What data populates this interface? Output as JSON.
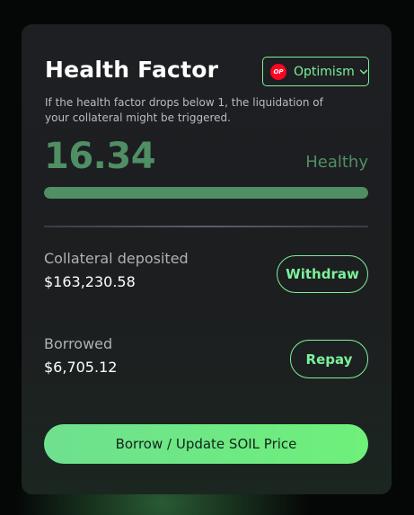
{
  "card": {
    "title": "Health Factor",
    "network": {
      "logo_text": "OP",
      "name": "Optimism",
      "icon": "chevron-down-icon"
    },
    "description": "If the health factor drops below 1, the liquidation of your collateral might be triggered.",
    "health_factor": {
      "value": "16.34",
      "status": "Healthy",
      "bar_fill_percent": 100
    },
    "collateral": {
      "label": "Collateral deposited",
      "amount": "$163,230.58",
      "action": "Withdraw"
    },
    "borrowed": {
      "label": "Borrowed",
      "amount": "$6,705.12",
      "action": "Repay"
    },
    "main_action": "Borrow / Update SOIL Price"
  },
  "colors": {
    "accent": "#7bf09a",
    "healthy": "#4f8f63",
    "optimism_red": "#ff0420",
    "card_bg": "#1e1f22"
  }
}
